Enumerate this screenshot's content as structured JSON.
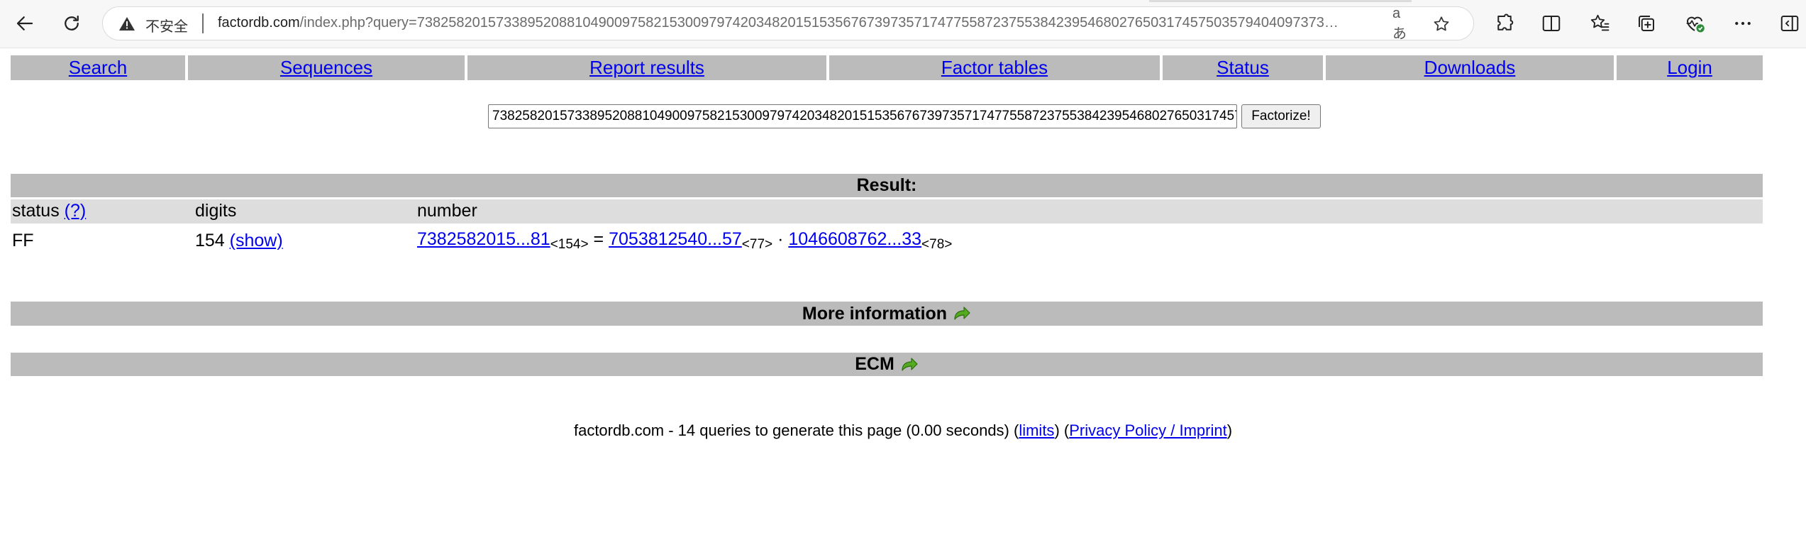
{
  "browser": {
    "security_label": "不安全",
    "url_host": "factordb.com",
    "url_path": "/index.php?query=7382582015733895208810490097582153009797420348201515356767397357174775587237553842395468027650317457503579404097373…",
    "read_aloud_glyph": "aあ"
  },
  "nav": {
    "items": [
      "Search",
      "Sequences",
      "Report results",
      "Factor tables",
      "Status",
      "Downloads",
      "Login"
    ]
  },
  "search": {
    "query_value": "7382582015733895208810490097582153009797420348201515356767397357174775587237553842395468027650317457503579404097373",
    "submit_label": "Factorize!"
  },
  "result": {
    "title": "Result:",
    "headers": {
      "status": "status",
      "status_help": "(?)",
      "digits": "digits",
      "number": "number"
    },
    "row": {
      "status": "FF",
      "digits": "154",
      "show_link": "(show)",
      "number": "7382582015...81",
      "number_len": "<154>",
      "equals": "=",
      "factor1": "7053812540...57",
      "factor1_len": "<77>",
      "dot": "·",
      "factor2": "1046608762...33",
      "factor2_len": "<78>"
    }
  },
  "sections": {
    "more_info": "More information",
    "ecm": "ECM"
  },
  "footer": {
    "text": "factordb.com - 14 queries to generate this page (0.00 seconds) (",
    "limits_link": "limits",
    "mid": ") (",
    "privacy_link": "Privacy Policy / Imprint",
    "end": ")"
  },
  "colors": {
    "bar_gray": "#bbbbbb",
    "header_gray": "#dddddd",
    "link_blue": "#0000ee",
    "arrow_green": "#55aa22"
  }
}
